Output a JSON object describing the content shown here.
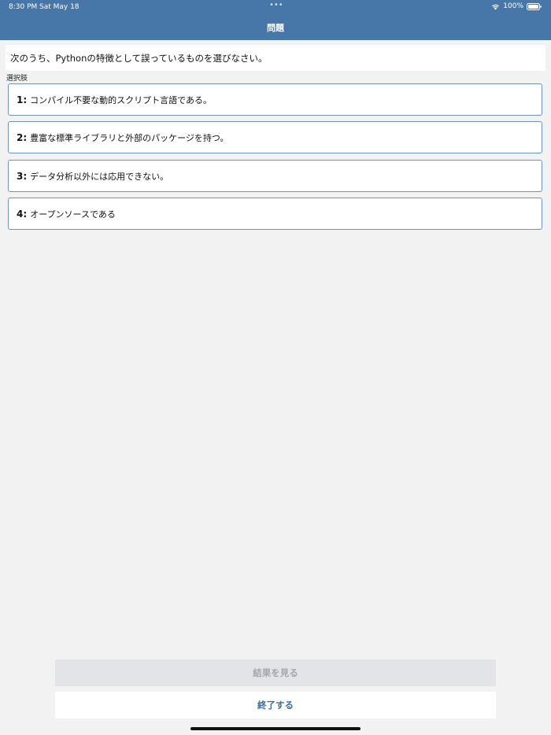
{
  "status_bar": {
    "time": "8:30 PM",
    "date": "Sat May 18",
    "dots": "•••",
    "battery": "100%"
  },
  "nav": {
    "title": "問題"
  },
  "question": {
    "text": "次のうち、Pythonの特徴として誤っているものを選びなさい。"
  },
  "choices_label": "選択肢",
  "choices": [
    {
      "num": "1:",
      "text": "コンパイル不要な動的スクリプト言語である。"
    },
    {
      "num": "2:",
      "text": "豊富な標準ライブラリと外部のパッケージを持つ。"
    },
    {
      "num": "3:",
      "text": "データ分析以外には応用できない。"
    },
    {
      "num": "4:",
      "text": "オープンソースである"
    }
  ],
  "buttons": {
    "result": "結果を見る",
    "exit": "終了する"
  },
  "colors": {
    "header": "#4677a8",
    "choice_border": "#6f95bd",
    "exit_text": "#3d6ea3",
    "disabled_bg": "#e2e4e7"
  }
}
